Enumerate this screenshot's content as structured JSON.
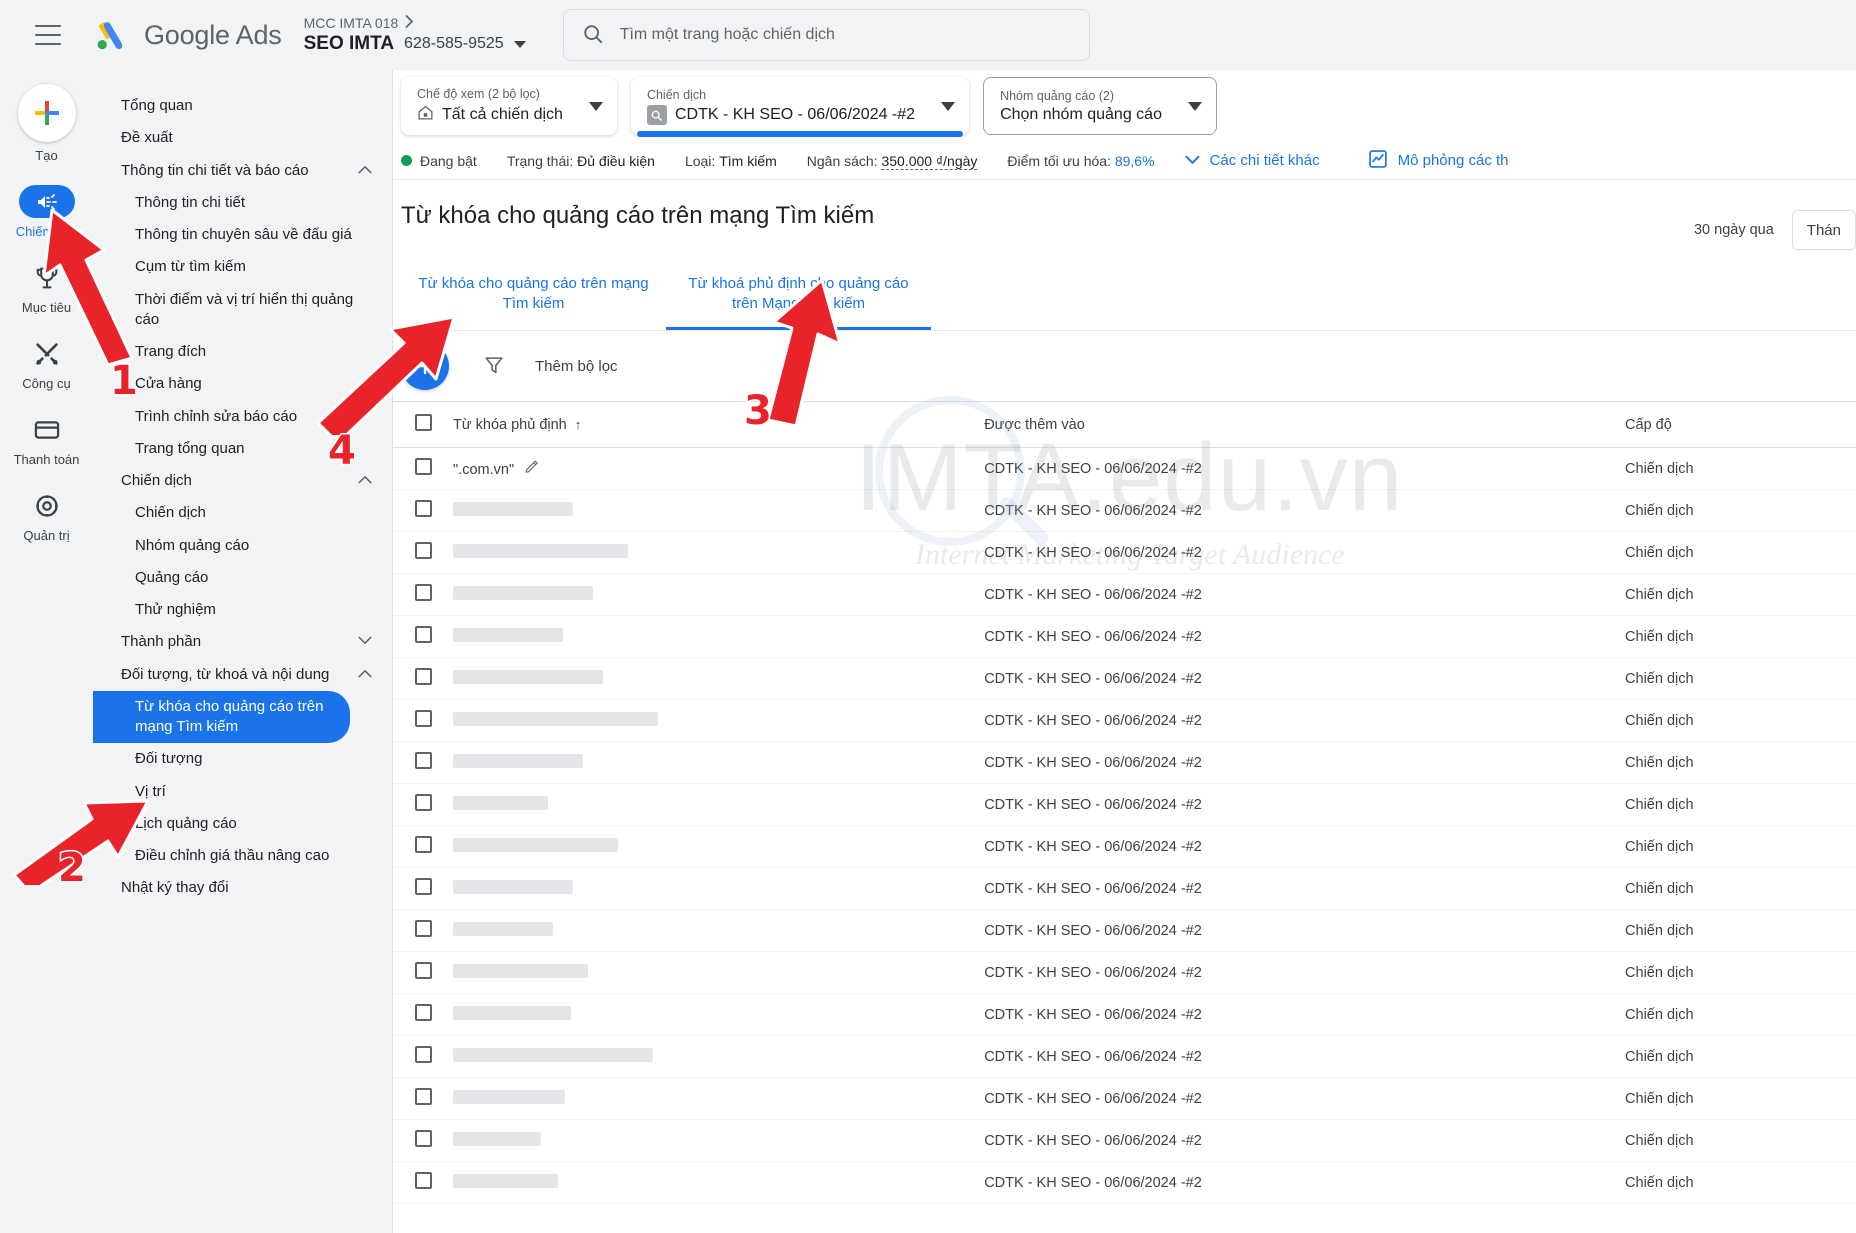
{
  "header": {
    "menu_icon": "hamburger-icon",
    "brand": "Google Ads",
    "mcc_label": "MCC IMTA 018",
    "account_name": "SEO IMTA",
    "account_id": "628-585-9525",
    "search_placeholder": "Tìm một trang hoặc chiến dịch",
    "search_value": "",
    "search_icon": "search-icon"
  },
  "rail": [
    {
      "label": "Tạo",
      "icon": "plus-icon",
      "active": false
    },
    {
      "label": "Chiến dịch",
      "icon": "megaphone-icon",
      "active": true
    },
    {
      "label": "Mục tiêu",
      "icon": "trophy-icon",
      "active": false
    },
    {
      "label": "Công cụ",
      "icon": "tools-icon",
      "active": false
    },
    {
      "label": "Thanh toán",
      "icon": "credit-card-icon",
      "active": false
    },
    {
      "label": "Quản trị",
      "icon": "gear-icon",
      "active": false
    }
  ],
  "nav": [
    {
      "label": "Tổng quan",
      "level": 0,
      "chevron": null,
      "selected": false
    },
    {
      "label": "Đề xuất",
      "level": 0,
      "chevron": null,
      "selected": false
    },
    {
      "label": "Thông tin chi tiết và báo cáo",
      "level": 0,
      "chevron": "up",
      "selected": false
    },
    {
      "label": "Thông tin chi tiết",
      "level": 1,
      "chevron": null,
      "selected": false
    },
    {
      "label": "Thông tin chuyên sâu về đấu giá",
      "level": 1,
      "chevron": null,
      "selected": false
    },
    {
      "label": "Cụm từ tìm kiếm",
      "level": 1,
      "chevron": null,
      "selected": false
    },
    {
      "label": "Thời điểm và vị trí hiển thị quảng cáo",
      "level": 1,
      "chevron": null,
      "selected": false
    },
    {
      "label": "Trang đích",
      "level": 1,
      "chevron": null,
      "selected": false
    },
    {
      "label": "Cửa hàng",
      "level": 1,
      "chevron": null,
      "selected": false
    },
    {
      "label": "Trình chỉnh sửa báo cáo",
      "level": 1,
      "chevron": null,
      "selected": false
    },
    {
      "label": "Trang tổng quan",
      "level": 1,
      "chevron": null,
      "selected": false
    },
    {
      "label": "Chiến dịch",
      "level": 0,
      "chevron": "up",
      "selected": false
    },
    {
      "label": "Chiến dịch",
      "level": 1,
      "chevron": null,
      "selected": false
    },
    {
      "label": "Nhóm quảng cáo",
      "level": 1,
      "chevron": null,
      "selected": false
    },
    {
      "label": "Quảng cáo",
      "level": 1,
      "chevron": null,
      "selected": false
    },
    {
      "label": "Thử nghiệm",
      "level": 1,
      "chevron": null,
      "selected": false
    },
    {
      "label": "Thành phần",
      "level": 0,
      "chevron": "down",
      "selected": false
    },
    {
      "label": "Đối tượng, từ khoá và nội dung",
      "level": 0,
      "chevron": "up",
      "selected": false
    },
    {
      "label": "Từ khóa cho quảng cáo trên mạng Tìm kiếm",
      "level": 1,
      "chevron": null,
      "selected": true
    },
    {
      "label": "Đối tượng",
      "level": 1,
      "chevron": null,
      "selected": false
    },
    {
      "label": "Vị trí",
      "level": 1,
      "chevron": null,
      "selected": false
    },
    {
      "label": "Lịch quảng cáo",
      "level": 1,
      "chevron": null,
      "selected": false
    },
    {
      "label": "Điều chỉnh giá thầu nâng cao",
      "level": 1,
      "chevron": null,
      "selected": false
    },
    {
      "label": "Nhật ký thay đổi",
      "level": 0,
      "chevron": null,
      "selected": false
    }
  ],
  "filters": [
    {
      "name": "view-mode",
      "label": "Chế độ xem (2 bộ lọc)",
      "value": "Tất cả chiến dịch",
      "icon": "home-icon",
      "style": "card",
      "underline": true,
      "focused": false
    },
    {
      "name": "campaign",
      "label": "Chiến dịch",
      "value": "CDTK - KH SEO - 06/06/2024 -#2",
      "icon": "search-square-icon",
      "style": "card",
      "underline": false,
      "focused": true
    },
    {
      "name": "ad-group",
      "label": "Nhóm quảng cáo (2)",
      "value": "Chọn nhóm quảng cáo",
      "icon": null,
      "style": "outline",
      "underline": false,
      "focused": false
    }
  ],
  "status": {
    "state": "Đang bật",
    "status_label": "Trạng thái:",
    "status_value": "Đủ điều kiện",
    "type_label": "Loại:",
    "type_value": "Tìm kiếm",
    "budget_label": "Ngân sách:",
    "budget_value": "350.000 ₫/ngày",
    "optscore_label": "Điểm tối ưu hóa:",
    "optscore_value": "89,6%",
    "more_details": "Các chi tiết khác",
    "simulate": "Mô phỏng các th",
    "chevron_icon": "chevron-down-icon",
    "simulate_icon": "chart-square-icon"
  },
  "page": {
    "title": "Từ khóa cho quảng cáo trên mạng Tìm kiếm",
    "date_range": "30 ngày qua",
    "date_picker": "Thán"
  },
  "tabs": [
    {
      "label": "Từ khóa cho quảng cáo trên mạng Tìm kiếm",
      "active": false
    },
    {
      "label": "Từ khoá phủ định cho quảng cáo trên Mạng Tìm kiếm",
      "active": true
    }
  ],
  "toolbar": {
    "add_icon": "plus-icon",
    "filter_icon": "filter-funnel-icon",
    "add_filter_label": "Thêm bộ lọc"
  },
  "table": {
    "columns": [
      {
        "key": "checkbox",
        "label": "",
        "icon": "checkbox-icon"
      },
      {
        "key": "keyword",
        "label": "Từ khóa phủ định",
        "sort": "↑"
      },
      {
        "key": "added_to",
        "label": "Được thêm vào"
      },
      {
        "key": "level",
        "label": "Cấp độ"
      }
    ],
    "rows": [
      {
        "keyword": "\".com.vn\"",
        "redacted": false,
        "redact_w": 0,
        "added_to": "CDTK - KH SEO - 06/06/2024 -#2",
        "level": "Chiến dịch",
        "edit_icon": "pencil-icon"
      },
      {
        "keyword": "",
        "redacted": true,
        "redact_w": 120,
        "added_to": "CDTK - KH SEO - 06/06/2024 -#2",
        "level": "Chiến dịch"
      },
      {
        "keyword": "",
        "redacted": true,
        "redact_w": 175,
        "added_to": "CDTK - KH SEO - 06/06/2024 -#2",
        "level": "Chiến dịch"
      },
      {
        "keyword": "",
        "redacted": true,
        "redact_w": 140,
        "added_to": "CDTK - KH SEO - 06/06/2024 -#2",
        "level": "Chiến dịch"
      },
      {
        "keyword": "",
        "redacted": true,
        "redact_w": 110,
        "added_to": "CDTK - KH SEO - 06/06/2024 -#2",
        "level": "Chiến dịch"
      },
      {
        "keyword": "",
        "redacted": true,
        "redact_w": 150,
        "added_to": "CDTK - KH SEO - 06/06/2024 -#2",
        "level": "Chiến dịch"
      },
      {
        "keyword": "",
        "redacted": true,
        "redact_w": 205,
        "added_to": "CDTK - KH SEO - 06/06/2024 -#2",
        "level": "Chiến dịch"
      },
      {
        "keyword": "",
        "redacted": true,
        "redact_w": 130,
        "added_to": "CDTK - KH SEO - 06/06/2024 -#2",
        "level": "Chiến dịch"
      },
      {
        "keyword": "",
        "redacted": true,
        "redact_w": 95,
        "added_to": "CDTK - KH SEO - 06/06/2024 -#2",
        "level": "Chiến dịch"
      },
      {
        "keyword": "",
        "redacted": true,
        "redact_w": 165,
        "added_to": "CDTK - KH SEO - 06/06/2024 -#2",
        "level": "Chiến dịch"
      },
      {
        "keyword": "",
        "redacted": true,
        "redact_w": 120,
        "added_to": "CDTK - KH SEO - 06/06/2024 -#2",
        "level": "Chiến dịch"
      },
      {
        "keyword": "",
        "redacted": true,
        "redact_w": 100,
        "added_to": "CDTK - KH SEO - 06/06/2024 -#2",
        "level": "Chiến dịch"
      },
      {
        "keyword": "",
        "redacted": true,
        "redact_w": 135,
        "added_to": "CDTK - KH SEO - 06/06/2024 -#2",
        "level": "Chiến dịch"
      },
      {
        "keyword": "",
        "redacted": true,
        "redact_w": 118,
        "added_to": "CDTK - KH SEO - 06/06/2024 -#2",
        "level": "Chiến dịch"
      },
      {
        "keyword": "",
        "redacted": true,
        "redact_w": 200,
        "added_to": "CDTK - KH SEO - 06/06/2024 -#2",
        "level": "Chiến dịch"
      },
      {
        "keyword": "",
        "redacted": true,
        "redact_w": 112,
        "added_to": "CDTK - KH SEO - 06/06/2024 -#2",
        "level": "Chiến dịch"
      },
      {
        "keyword": "",
        "redacted": true,
        "redact_w": 88,
        "added_to": "CDTK - KH SEO - 06/06/2024 -#2",
        "level": "Chiến dịch"
      },
      {
        "keyword": "",
        "redacted": true,
        "redact_w": 105,
        "added_to": "CDTK - KH SEO - 06/06/2024 -#2",
        "level": "Chiến dịch"
      }
    ]
  },
  "annotations": [
    {
      "number": "1",
      "target": "sidebar-campaigns-icon"
    },
    {
      "number": "2",
      "target": "sidebar-search-keywords-item"
    },
    {
      "number": "3",
      "target": "negative-keywords-tab"
    },
    {
      "number": "4",
      "target": "add-keyword-button"
    }
  ],
  "watermark": {
    "main": "IMTA.edu.vn",
    "sub": "Internet Marketing Target Audience"
  },
  "colors": {
    "accent": "#1a73e8",
    "chrome_bg": "#f1f3f4",
    "text": "#202124",
    "muted": "#5f6368",
    "green": "#0f9d58",
    "annotation_red": "#e8232a"
  }
}
